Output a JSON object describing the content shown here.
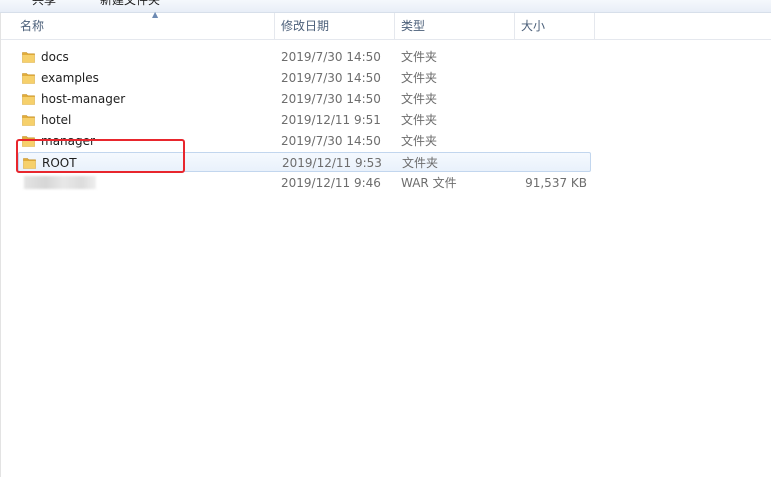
{
  "toolbar": {
    "share_label": "共享",
    "new_folder_label": "新建文件夹"
  },
  "columns": {
    "name": "名称",
    "date_modified": "修改日期",
    "type": "类型",
    "size": "大小"
  },
  "files": [
    {
      "name": "docs",
      "date": "2019/7/30 14:50",
      "type": "文件夹",
      "size": "",
      "icon": "folder-icon"
    },
    {
      "name": "examples",
      "date": "2019/7/30 14:50",
      "type": "文件夹",
      "size": "",
      "icon": "folder-icon"
    },
    {
      "name": "host-manager",
      "date": "2019/7/30 14:50",
      "type": "文件夹",
      "size": "",
      "icon": "folder-icon"
    },
    {
      "name": "hotel",
      "date": "2019/12/11 9:51",
      "type": "文件夹",
      "size": "",
      "icon": "folder-icon"
    },
    {
      "name": "manager",
      "date": "2019/7/30 14:50",
      "type": "文件夹",
      "size": "",
      "icon": "folder-icon"
    },
    {
      "name": "ROOT",
      "date": "2019/12/11 9:53",
      "type": "文件夹",
      "size": "",
      "icon": "folder-icon",
      "selected": true
    },
    {
      "name": "",
      "date": "2019/12/11 9:46",
      "type": "WAR 文件",
      "size": "91,537 KB",
      "icon": "file-icon",
      "blurred": true
    }
  ],
  "colors": {
    "annotation": "#e8262d",
    "selection_border": "#c2d6ee",
    "header_text": "#4c607a",
    "folder_yellow": "#f2c55c"
  }
}
